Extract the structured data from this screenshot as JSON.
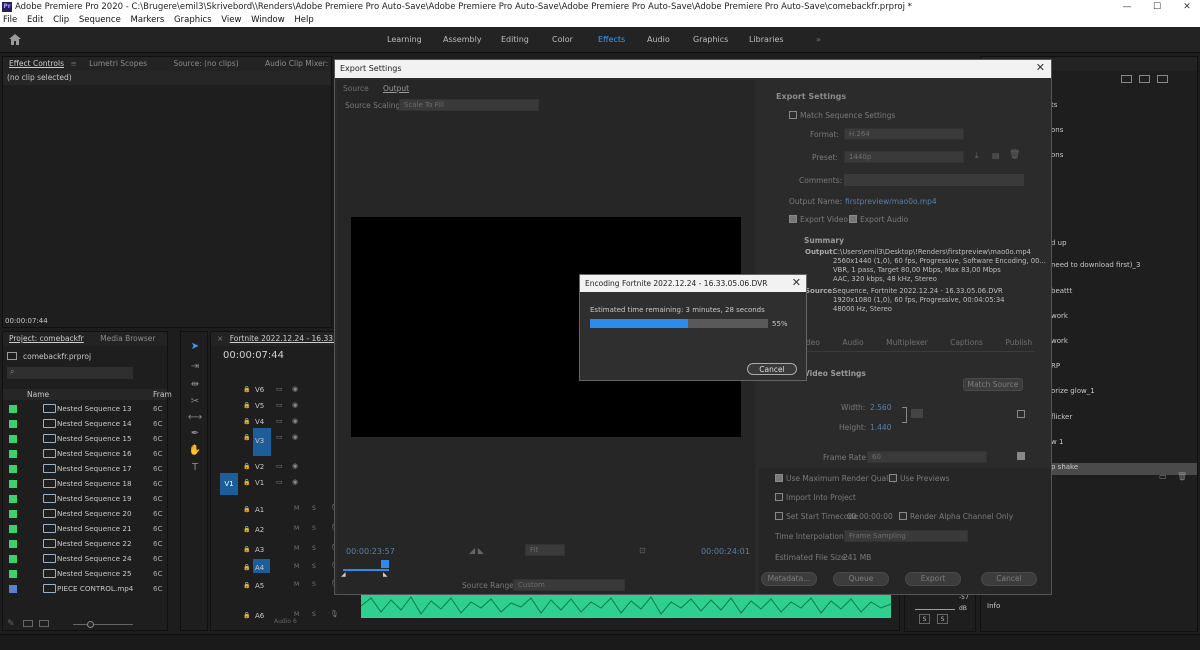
{
  "app": {
    "title": "Adobe Premiere Pro 2020 - C:\\Brugere\\emil3\\Skrivebord\\\\Renders\\Adobe Premiere Pro Auto-Save\\Adobe Premiere Pro Auto-Save\\Adobe Premiere Pro Auto-Save\\Adobe Premiere Pro Auto-Save\\comebackfr.prproj *",
    "logo": "Pr",
    "min": "—",
    "max": "☐",
    "close": "✕"
  },
  "menu": [
    "File",
    "Edit",
    "Clip",
    "Sequence",
    "Markers",
    "Graphics",
    "View",
    "Window",
    "Help"
  ],
  "workspaces": [
    "Learning",
    "Assembly",
    "Editing",
    "Color",
    "Effects",
    "Audio",
    "Graphics",
    "Libraries"
  ],
  "workspace_active": "Effects",
  "workspace_more": "»",
  "effect_panel": {
    "tabs": [
      "Effect Controls",
      "Lumetri Scopes",
      "Source: (no clips)",
      "Audio Clip Mixer: Fortnite 2022.1"
    ],
    "no_clip": "(no clip selected)",
    "timecode": "00:00:07:44"
  },
  "project": {
    "tabs": [
      "Project: comebackfr",
      "Media Browser"
    ],
    "file": "comebackfr.prproj",
    "col_name": "Name",
    "col_frame": "Fram",
    "items": [
      {
        "name": "Nested Sequence 13",
        "fr": "6C"
      },
      {
        "name": "Nested Sequence 14",
        "fr": "6C"
      },
      {
        "name": "Nested Sequence 15",
        "fr": "6C"
      },
      {
        "name": "Nested Sequence 16",
        "fr": "6C"
      },
      {
        "name": "Nested Sequence 17",
        "fr": "6C"
      },
      {
        "name": "Nested Sequence 18",
        "fr": "6C"
      },
      {
        "name": "Nested Sequence 19",
        "fr": "6C"
      },
      {
        "name": "Nested Sequence 20",
        "fr": "6C"
      },
      {
        "name": "Nested Sequence 21",
        "fr": "6C"
      },
      {
        "name": "Nested Sequence 22",
        "fr": "6C"
      },
      {
        "name": "Nested Sequence 24",
        "fr": "6C"
      },
      {
        "name": "Nested Sequence 25",
        "fr": "6C"
      },
      {
        "name": "PIECE CONTROL.mp4",
        "fr": "6C"
      }
    ]
  },
  "timeline": {
    "tab": "Fortnite 2022.12.24 - 16.33.05.06.DVR",
    "timecode": "00:00:07:44",
    "video_tracks": [
      "V6",
      "V5",
      "V4",
      "V3",
      "V2",
      "V1"
    ],
    "audio_tracks": [
      "A1",
      "A2",
      "A3",
      "A4",
      "A5",
      "A6"
    ],
    "src_v": "V1",
    "src_a": "A4",
    "audio6_name": "Audio 6"
  },
  "right_panel": {
    "items": [
      "ts",
      "ons",
      "ons",
      "d up",
      "need to download first)_3",
      "beattt",
      "work",
      "work",
      "RP",
      "orize glow_1",
      "flicker",
      "w 1",
      "p shake"
    ],
    "meter": [
      "-57",
      "dB"
    ],
    "ss": [
      "S",
      "S"
    ],
    "info": "Info"
  },
  "export": {
    "title": "Export Settings",
    "tabs": [
      "Source",
      "Output"
    ],
    "scaling_label": "Source Scaling:",
    "scaling_value": "Scale To Fill",
    "tc_left": "00:00:23:57",
    "tc_right": "00:00:24:01",
    "fit": "Fit",
    "range_label": "Source Range:",
    "range_value": "Custom",
    "settings_title": "Export Settings",
    "match_seq": "Match Sequence Settings",
    "format_label": "Format:",
    "format": "H.264",
    "preset_label": "Preset:",
    "preset": "1440p",
    "comments_label": "Comments:",
    "output_label": "Output Name:",
    "output_name": "firstpreview/mao0o.mp4",
    "export_video": "Export Video",
    "export_audio": "Export Audio",
    "summary": "Summary",
    "summary_output_label": "Output:",
    "summary_output": [
      "C:\\Users\\emil3\\Desktop\\!Renders\\firstpreview\\mao0o.mp4",
      "2560x1440 (1,0), 60 fps, Progressive, Software Encoding, 00...",
      "VBR, 1 pass, Target 80,00 Mbps, Max 83,00 Mbps",
      "AAC, 320 kbps, 48 kHz, Stereo"
    ],
    "summary_source_label": "Source:",
    "summary_source": [
      "Sequence, Fortnite 2022.12.24 - 16.33.05.06.DVR",
      "1920x1080 (1,0), 60 fps, Progressive, 00:04:05:34",
      "48000 Hz, Stereo"
    ],
    "tabs2": [
      "Video",
      "Audio",
      "Multiplexer",
      "Captions",
      "Publish"
    ],
    "video_settings": "Video Settings",
    "match_source": "Match Source",
    "width_label": "Width:",
    "width": "2.560",
    "height_label": "Height:",
    "height": "1.440",
    "framerate_label": "Frame Rate:",
    "framerate": "60",
    "max_quality": "Use Maximum Render Quality",
    "use_previews": "Use Previews",
    "import_project": "Import Into Project",
    "set_start": "Set Start Timecode",
    "start_tc": "00:00:00:00",
    "render_alpha": "Render Alpha Channel Only",
    "interp_label": "Time Interpolation:",
    "interp": "Frame Sampling",
    "filesize_label": "Estimated File Size:",
    "filesize": "241 MB",
    "buttons": [
      "Metadata...",
      "Queue",
      "Export",
      "Cancel"
    ]
  },
  "encoding": {
    "title": "Encoding Fortnite 2022.12.24 - 16.33.05.06.DVR",
    "remaining": "Estimated time remaining: 3 minutes, 28 seconds",
    "progress": 55,
    "percent": "55%",
    "cancel": "Cancel"
  },
  "colors": {
    "accent": "#2d8ceb",
    "seq_green": "#3ed06a",
    "track_blue": "#1d5e9a",
    "audio_wave": "#2fcf8f"
  }
}
